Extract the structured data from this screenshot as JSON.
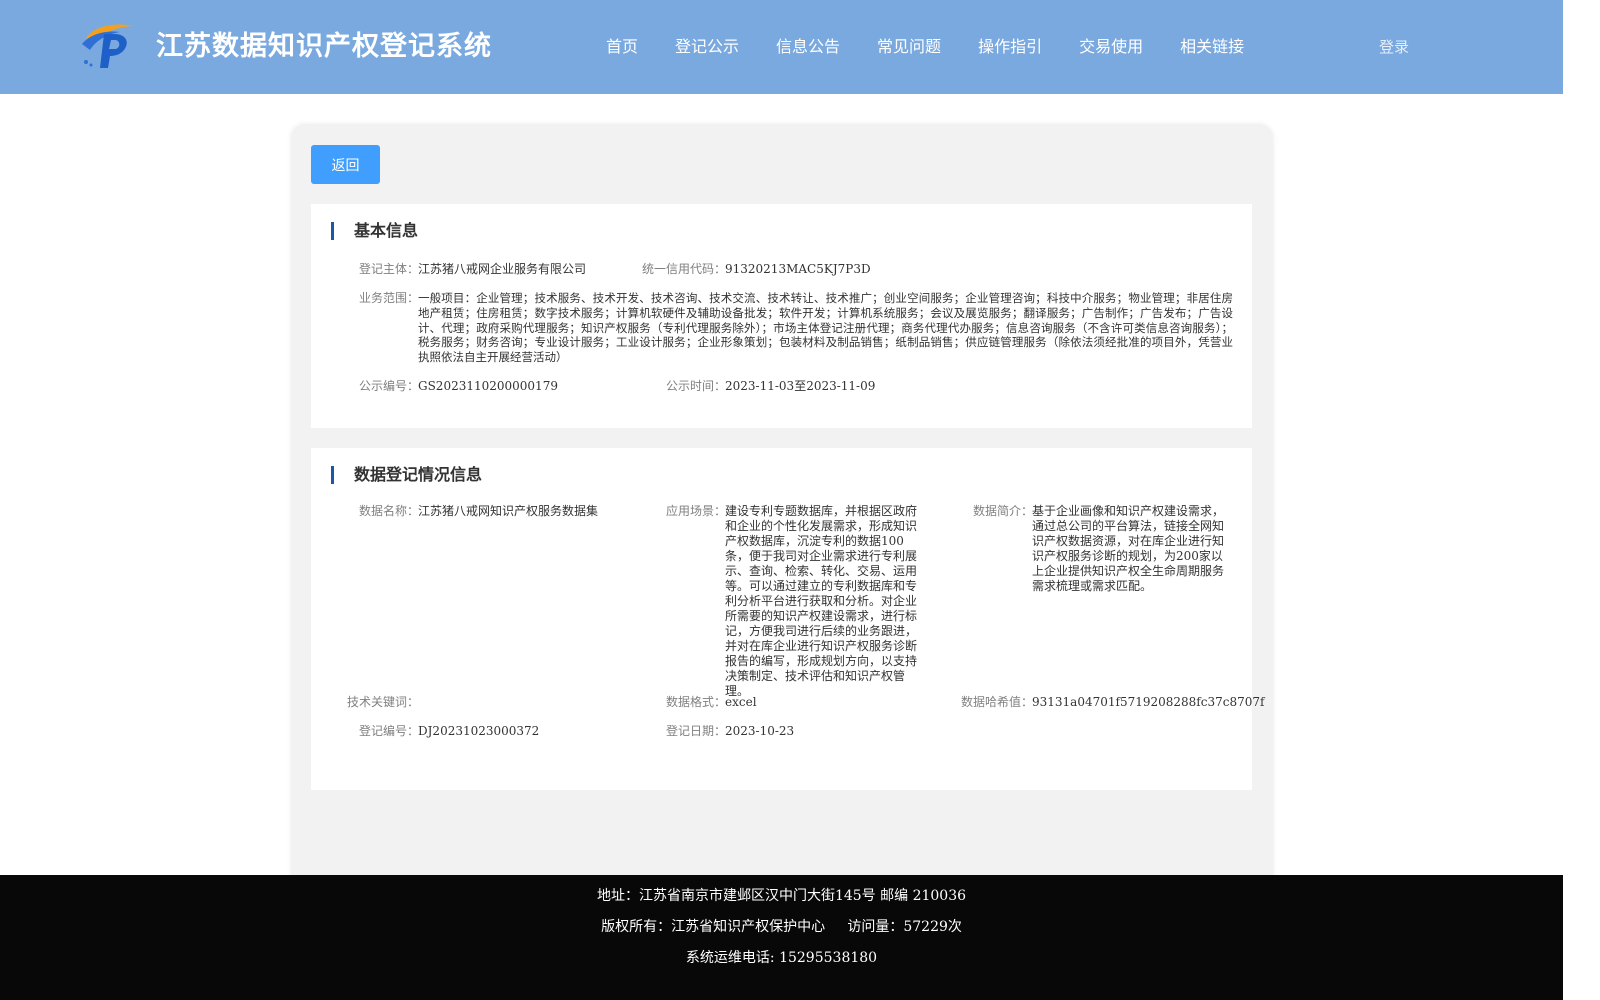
{
  "header": {
    "title": "江苏数据知识产权登记系统",
    "nav": [
      "首页",
      "登记公示",
      "信息公告",
      "常见问题",
      "操作指引",
      "交易使用",
      "相关链接"
    ],
    "login": "登录"
  },
  "back_label": "返回",
  "basic": {
    "title": "基本信息",
    "subject_label": "登记主体：",
    "subject": "江苏猪八戒网企业服务有限公司",
    "credit_label": "统一信用代码：",
    "credit": "91320213MAC5KJ7P3D",
    "scope_label": "业务范围：",
    "scope": "一般项目：企业管理；技术服务、技术开发、技术咨询、技术交流、技术转让、技术推广；创业空间服务；企业管理咨询；科技中介服务；物业管理；非居住房地产租赁；住房租赁；数字技术服务；计算机软硬件及辅助设备批发；软件开发；计算机系统服务；会议及展览服务；翻译服务；广告制作；广告发布；广告设计、代理；政府采购代理服务；知识产权服务（专利代理服务除外）；市场主体登记注册代理；商务代理代办服务；信息咨询服务（不含许可类信息咨询服务）；税务服务；财务咨询；专业设计服务；工业设计服务；企业形象策划；包装材料及制品销售；纸制品销售；供应链管理服务（除依法须经批准的项目外，凭营业执照依法自主开展经营活动）",
    "pub_no_label": "公示编号：",
    "pub_no": "GS2023110200000179",
    "pub_time_label": "公示时间：",
    "pub_time": "2023-11-03至2023-11-09"
  },
  "data_reg": {
    "title": "数据登记情况信息",
    "name_label": "数据名称：",
    "name": "江苏猪八戒网知识产权服务数据集",
    "scene_label": "应用场景：",
    "scene": "建设专利专题数据库，并根据区政府和企业的个性化发展需求，形成知识产权数据库，沉淀专利的数据100条，便于我司对企业需求进行专利展示、查询、检索、转化、交易、运用等。可以通过建立的专利数据库和专利分析平台进行获取和分析。对企业所需要的知识产权建设需求，进行标记，方便我司进行后续的业务跟进，并对在库企业进行知识产权服务诊断报告的编写，形成规划方向，以支持决策制定、技术评估和知识产权管理。",
    "intro_label": "数据简介：",
    "intro": "基于企业画像和知识产权建设需求，通过总公司的平台算法，链接全网知识产权数据资源，对在库企业进行知识产权服务诊断的规划，为200家以上企业提供知识产权全生命周期服务需求梳理或需求匹配。",
    "keywords_label": "技术关键词：",
    "keywords": "",
    "format_label": "数据格式：",
    "format": "excel",
    "hash_label": "数据哈希值：",
    "hash": "93131a04701f5719208288fc37c8707f",
    "reg_no_label": "登记编号：",
    "reg_no": "DJ20231023000372",
    "reg_date_label": "登记日期：",
    "reg_date": "2023-10-23"
  },
  "footer": {
    "address": "地址：江苏省南京市建邺区汉中门大街145号 邮编 210036",
    "copyright": "版权所有：江苏省知识产权保护中心",
    "visits_label": "访问量：",
    "visits": "57229次",
    "phone": "系统运维电话: 15295538180"
  },
  "colors": {
    "header_bg": "#79a9df",
    "primary_button": "#409eff",
    "section_accent": "#1a57a8",
    "footer_bg": "#080808"
  }
}
